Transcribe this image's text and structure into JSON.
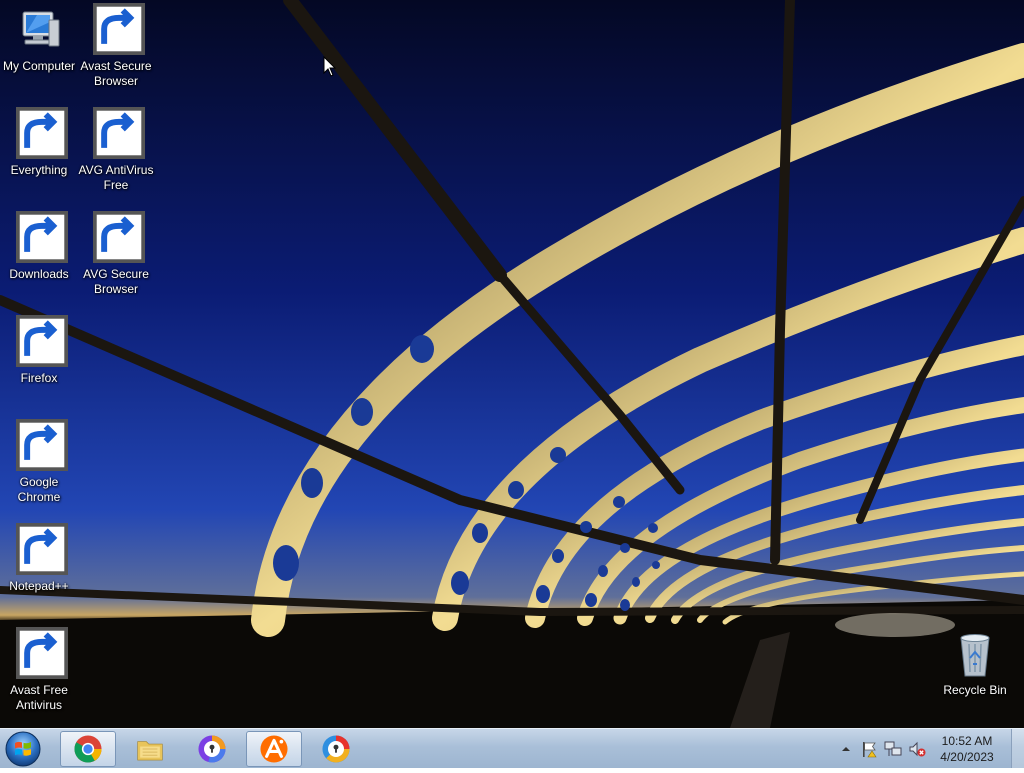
{
  "desktop": {
    "icons": [
      {
        "name": "my-computer",
        "label": "My Computer"
      },
      {
        "name": "avast-secure-browser",
        "label": "Avast Secure Browser"
      },
      {
        "name": "everything",
        "label": "Everything"
      },
      {
        "name": "avg-antivirus-free",
        "label": "AVG AntiVirus Free"
      },
      {
        "name": "downloads",
        "label": "Downloads"
      },
      {
        "name": "avg-secure-browser",
        "label": "AVG Secure Browser"
      },
      {
        "name": "firefox",
        "label": "Firefox"
      },
      {
        "name": "google-chrome",
        "label": "Google Chrome"
      },
      {
        "name": "notepad-plus-plus",
        "label": "Notepad++"
      },
      {
        "name": "avast-free-antivirus",
        "label": "Avast Free Antivirus"
      },
      {
        "name": "recycle-bin",
        "label": "Recycle Bin"
      }
    ]
  },
  "taskbar": {
    "start_icon": "windows-logo-icon",
    "pinned": [
      {
        "icon": "chrome-icon",
        "active": true
      },
      {
        "icon": "file-explorer-icon",
        "active": false
      },
      {
        "icon": "avast-secure-browser-icon",
        "active": false
      },
      {
        "icon": "avast-antivirus-icon",
        "active": true
      },
      {
        "icon": "avg-secure-browser-icon",
        "active": false
      }
    ],
    "tray": {
      "icons": [
        "show-hidden-icons-chevron-icon",
        "action-center-flag-icon",
        "network-icon",
        "volume-muted-icon"
      ],
      "time": "10:52 AM",
      "date": "4/20/2023"
    }
  },
  "colors": {
    "taskbar": "#a9bfd8",
    "sky_top": "#050a2a",
    "sky_mid": "#1c3aa0",
    "bridge_light": "#f2d98a"
  }
}
